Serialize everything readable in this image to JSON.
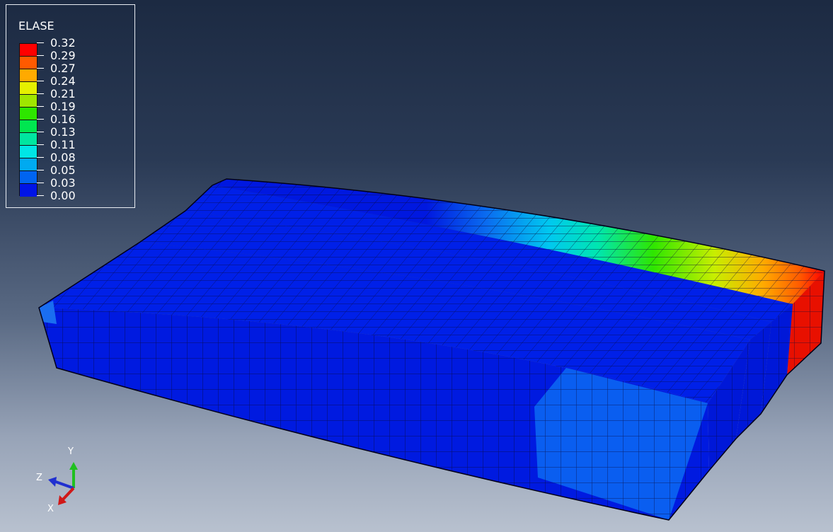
{
  "legend": {
    "title": "ELASE",
    "values": [
      "0.32",
      "0.29",
      "0.27",
      "0.24",
      "0.21",
      "0.19",
      "0.16",
      "0.13",
      "0.11",
      "0.08",
      "0.05",
      "0.03",
      "0.00"
    ],
    "colors": [
      "#ff0000",
      "#ff5a00",
      "#ffaa00",
      "#e6f000",
      "#a0e600",
      "#2ee600",
      "#00e650",
      "#00e6a0",
      "#00e6e6",
      "#00aaf0",
      "#0064f0",
      "#0014e6"
    ]
  },
  "triad": {
    "x_label": "X",
    "y_label": "Y",
    "z_label": "Z"
  }
}
